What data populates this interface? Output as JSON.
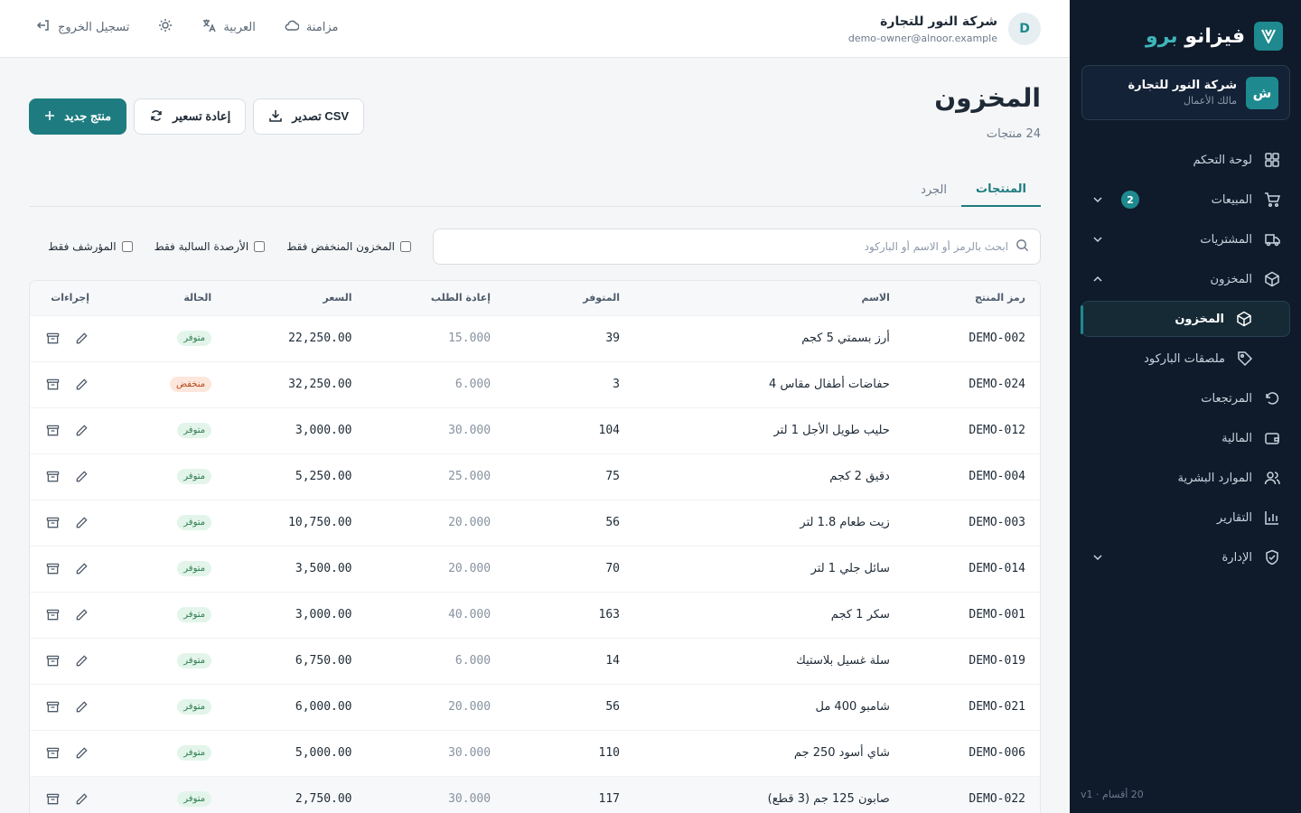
{
  "brand": {
    "name": "فيزانو",
    "suffix": "برو"
  },
  "org": {
    "initial": "ش",
    "name": "شركة النور للتجارة",
    "role": "مالك الأعمال"
  },
  "nav": {
    "dashboard": "لوحة التحكم",
    "sales": "المبيعات",
    "sales_badge": "2",
    "purchases": "المشتريات",
    "inventory": "المخزون",
    "inventory_sub": "المخزون",
    "barcode_labels": "ملصقات الباركود",
    "returns": "المرتجعات",
    "finance": "المالية",
    "hr": "الموارد البشرية",
    "reports": "التقارير",
    "admin": "الإدارة"
  },
  "footer": "20 أقسام · v1",
  "user": {
    "initial": "D",
    "name": "شركة النور للتجارة",
    "email": "demo-owner@alnoor.example"
  },
  "topbar": {
    "sync": "مزامنة",
    "language": "العربية",
    "logout": "تسجيل الخروج"
  },
  "page": {
    "title": "المخزون",
    "subtitle": "24 منتجات",
    "export_csv": "تصدير CSV",
    "reprice": "إعادة تسعير",
    "new_product": "منتج جديد"
  },
  "tabs": {
    "products": "المنتجات",
    "stocktake": "الجرد"
  },
  "filters": {
    "search_placeholder": "ابحث بالرمز أو الاسم أو الباركود",
    "low_stock": "المخزون المنخفض فقط",
    "negative": "الأرصدة السالبة فقط",
    "archived": "المؤرشف فقط"
  },
  "table": {
    "headers": {
      "sku": "رمز المنتج",
      "name": "الاسم",
      "available": "المتوفر",
      "reorder": "إعادة الطلب",
      "price": "السعر",
      "status": "الحالة",
      "actions": "إجراءات"
    },
    "rows": [
      {
        "sku": "DEMO-002",
        "name": "أرز بسمتي 5 كجم",
        "available": "39",
        "reorder": "15.000",
        "price": "22,250.00",
        "status": "متوفر",
        "low": false
      },
      {
        "sku": "DEMO-024",
        "name": "حفاضات أطفال مقاس 4",
        "available": "3",
        "reorder": "6.000",
        "price": "32,250.00",
        "status": "منخفض",
        "low": true
      },
      {
        "sku": "DEMO-012",
        "name": "حليب طويل الأجل 1 لتر",
        "available": "104",
        "reorder": "30.000",
        "price": "3,000.00",
        "status": "متوفر",
        "low": false
      },
      {
        "sku": "DEMO-004",
        "name": "دقيق 2 كجم",
        "available": "75",
        "reorder": "25.000",
        "price": "5,250.00",
        "status": "متوفر",
        "low": false
      },
      {
        "sku": "DEMO-003",
        "name": "زيت طعام 1.8 لتر",
        "available": "56",
        "reorder": "20.000",
        "price": "10,750.00",
        "status": "متوفر",
        "low": false
      },
      {
        "sku": "DEMO-014",
        "name": "سائل جلي 1 لتر",
        "available": "70",
        "reorder": "20.000",
        "price": "3,500.00",
        "status": "متوفر",
        "low": false
      },
      {
        "sku": "DEMO-001",
        "name": "سكر 1 كجم",
        "available": "163",
        "reorder": "40.000",
        "price": "3,000.00",
        "status": "متوفر",
        "low": false
      },
      {
        "sku": "DEMO-019",
        "name": "سلة غسيل بلاستيك",
        "available": "14",
        "reorder": "6.000",
        "price": "6,750.00",
        "status": "متوفر",
        "low": false
      },
      {
        "sku": "DEMO-021",
        "name": "شامبو 400 مل",
        "available": "56",
        "reorder": "20.000",
        "price": "6,000.00",
        "status": "متوفر",
        "low": false
      },
      {
        "sku": "DEMO-006",
        "name": "شاي أسود 250 جم",
        "available": "110",
        "reorder": "30.000",
        "price": "5,000.00",
        "status": "متوفر",
        "low": false
      },
      {
        "sku": "DEMO-022",
        "name": "صابون 125 جم (3 قطع)",
        "available": "117",
        "reorder": "30.000",
        "price": "2,750.00",
        "status": "متوفر",
        "low": false
      }
    ]
  },
  "colors": {
    "accent": "#1e7c80",
    "sidebar_bg": "#0f1b2a",
    "status_ok": "#2e7d4f",
    "status_low": "#b54a1c"
  }
}
